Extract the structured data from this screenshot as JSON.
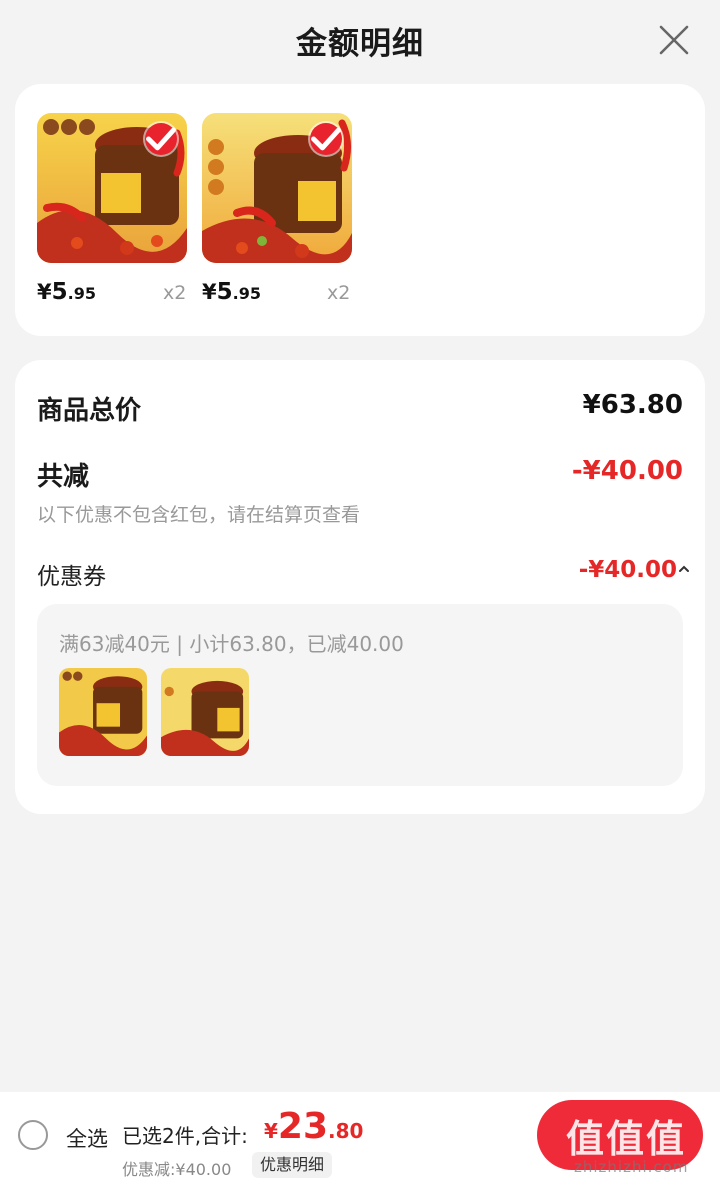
{
  "header": {
    "title": "金额明细",
    "close_icon": "close-icon"
  },
  "items": [
    {
      "price_currency": "¥",
      "price_int": "5",
      "price_dec": ".95",
      "qty": "x2",
      "checked": true
    },
    {
      "price_currency": "¥",
      "price_int": "5",
      "price_dec": ".95",
      "qty": "x2",
      "checked": true
    }
  ],
  "summary": {
    "total_label": "商品总价",
    "total_value": "¥63.80",
    "discount_label": "共减",
    "discount_value": "-¥40.00",
    "note": "以下优惠不包含红包，请在结算页查看",
    "coupon_label": "优惠券",
    "coupon_value": "-¥40.00",
    "coupon_desc": "满63减40元 | 小计63.80，已减40.00"
  },
  "footer": {
    "select_all": "全选",
    "selected_text": "已选2件,合计:",
    "total_currency": "¥",
    "total_int": "23",
    "total_dec": ".80",
    "saving": "优惠减:¥40.00",
    "detail_button": "优惠明细"
  },
  "watermark": {
    "text": "值值值",
    "sub": "zhizhizhi.com"
  },
  "colors": {
    "accent_red": "#e52727",
    "button_red": "#ef2b3a"
  }
}
